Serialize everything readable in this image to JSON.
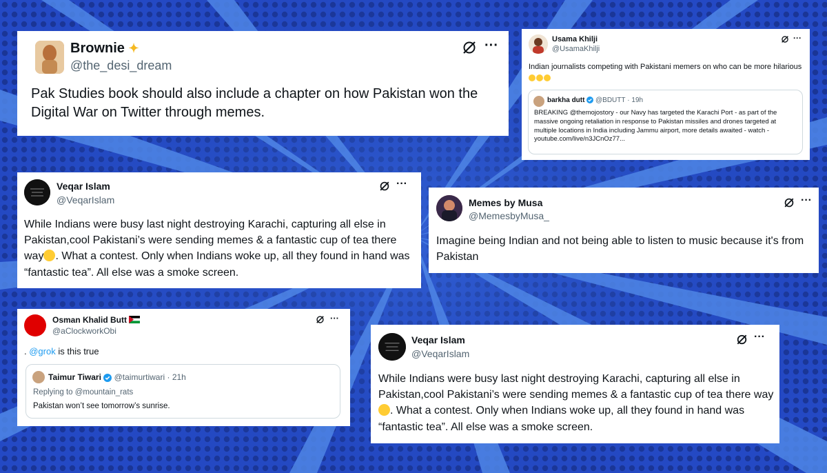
{
  "colors": {
    "background": "#1f46c8",
    "ray": "#4f86e6",
    "card": "#ffffff",
    "handle": "#536471",
    "link": "#1d9bf0",
    "verified": "#1d9bf0"
  },
  "icons": {
    "grok": "grok-icon",
    "more": "more-icon",
    "verified": "verified-badge-icon",
    "emoji_laugh": "laughing-emoji-icon",
    "emoji_smile": "smiling-emoji-icon",
    "sparkles": "sparkles-icon",
    "flag": "palestine-flag-icon"
  },
  "tweets": {
    "brownie": {
      "name": "Brownie",
      "handle": "@the_desi_dream",
      "text": "Pak Studies book should also include a chapter on how Pakistan won the Digital War on Twitter through memes."
    },
    "usama": {
      "name": "Usama Khilji",
      "handle": "@UsamaKhilji",
      "text": "Indian journalists competing with Pakistani memers on who can be more hilarious",
      "quote": {
        "name": "barkha dutt",
        "handle": "@BDUTT",
        "time": "· 19h",
        "text": "BREAKING @themojostory - our Navy has targeted the Karachi Port - as part of the massive ongoing retaliation in response to Pakistan missiles and drones targeted at multiple locations in India including Jammu airport, more details awaited - watch - youtube.com/live/n3JCnOz77..."
      }
    },
    "veqar1": {
      "name": "Veqar Islam",
      "handle": "@VeqarIslam",
      "text_before": "While Indians were busy last night destroying Karachi, capturing all else in Pakistan,cool Pakistani’s were sending memes & a fantastic cup of tea there way",
      "text_after": ". What a contest.  Only when Indians woke up, all they found in hand was “fantastic tea”. All else was a smoke screen."
    },
    "musa": {
      "name": "Memes by Musa",
      "handle": "@MemesbyMusa_",
      "text": "Imagine being Indian and not being able to listen to music because it's from Pakistan"
    },
    "osman": {
      "name": "Osman Khalid Butt",
      "handle": "@aClockworkObi",
      "text_prefix": ". ",
      "mention": "@grok",
      "text_rest": " is this true",
      "quote": {
        "name": "Taimur Tiwari",
        "handle": "@taimurtiwari",
        "time": "· 21h",
        "reply": "Replying to @mountain_rats",
        "text": "Pakistan won’t see tomorrow’s sunrise."
      }
    },
    "veqar2": {
      "name": "Veqar Islam",
      "handle": "@VeqarIslam",
      "text_before": "While Indians were busy last night destroying Karachi, capturing all else in Pakistan,cool Pakistani’s were sending memes & a fantastic cup of tea there way",
      "text_after": ". What a contest.  Only when Indians woke up, all they found in hand was “fantastic tea”. All else was a smoke screen."
    }
  }
}
